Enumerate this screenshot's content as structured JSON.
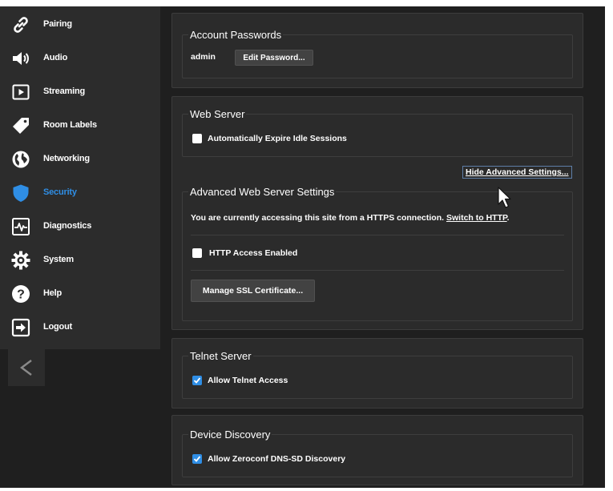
{
  "sidebar": {
    "items": [
      {
        "label": "Pairing",
        "icon": "link-icon",
        "active": false
      },
      {
        "label": "Audio",
        "icon": "speaker-icon",
        "active": false
      },
      {
        "label": "Streaming",
        "icon": "play-icon",
        "active": false
      },
      {
        "label": "Room Labels",
        "icon": "tag-icon",
        "active": false
      },
      {
        "label": "Networking",
        "icon": "globe-icon",
        "active": false
      },
      {
        "label": "Security",
        "icon": "shield-icon",
        "active": true
      },
      {
        "label": "Diagnostics",
        "icon": "pulse-icon",
        "active": false
      },
      {
        "label": "System",
        "icon": "gear-icon",
        "active": false
      },
      {
        "label": "Help",
        "icon": "question-icon",
        "active": false
      },
      {
        "label": "Logout",
        "icon": "logout-icon",
        "active": false
      }
    ],
    "collapse_glyph": "<"
  },
  "account": {
    "title": "Account Passwords",
    "username": "admin",
    "edit_label": "Edit Password..."
  },
  "web_server": {
    "title": "Web Server",
    "expire_label": "Automatically Expire Idle Sessions",
    "expire_checked": false,
    "toggle_label": "Hide Advanced Settings...",
    "advanced": {
      "title": "Advanced Web Server Settings",
      "connection_text": "You are currently accessing this site from a HTTPS connection.",
      "switch_link": "Switch to HTTP",
      "switch_suffix": ".",
      "http_label": "HTTP Access Enabled",
      "http_checked": false,
      "ssl_label": "Manage SSL Certificate..."
    }
  },
  "telnet": {
    "title": "Telnet Server",
    "allow_label": "Allow Telnet Access",
    "allow_checked": true
  },
  "discovery": {
    "title": "Device Discovery",
    "allow_label": "Allow Zeroconf DNS-SD Discovery",
    "allow_checked": true
  },
  "colors": {
    "accent": "#2f8ee5",
    "sidebar_bg": "#2c2c2c",
    "panel_bg": "#2b2b2b",
    "page_bg": "#1f1f1f"
  }
}
